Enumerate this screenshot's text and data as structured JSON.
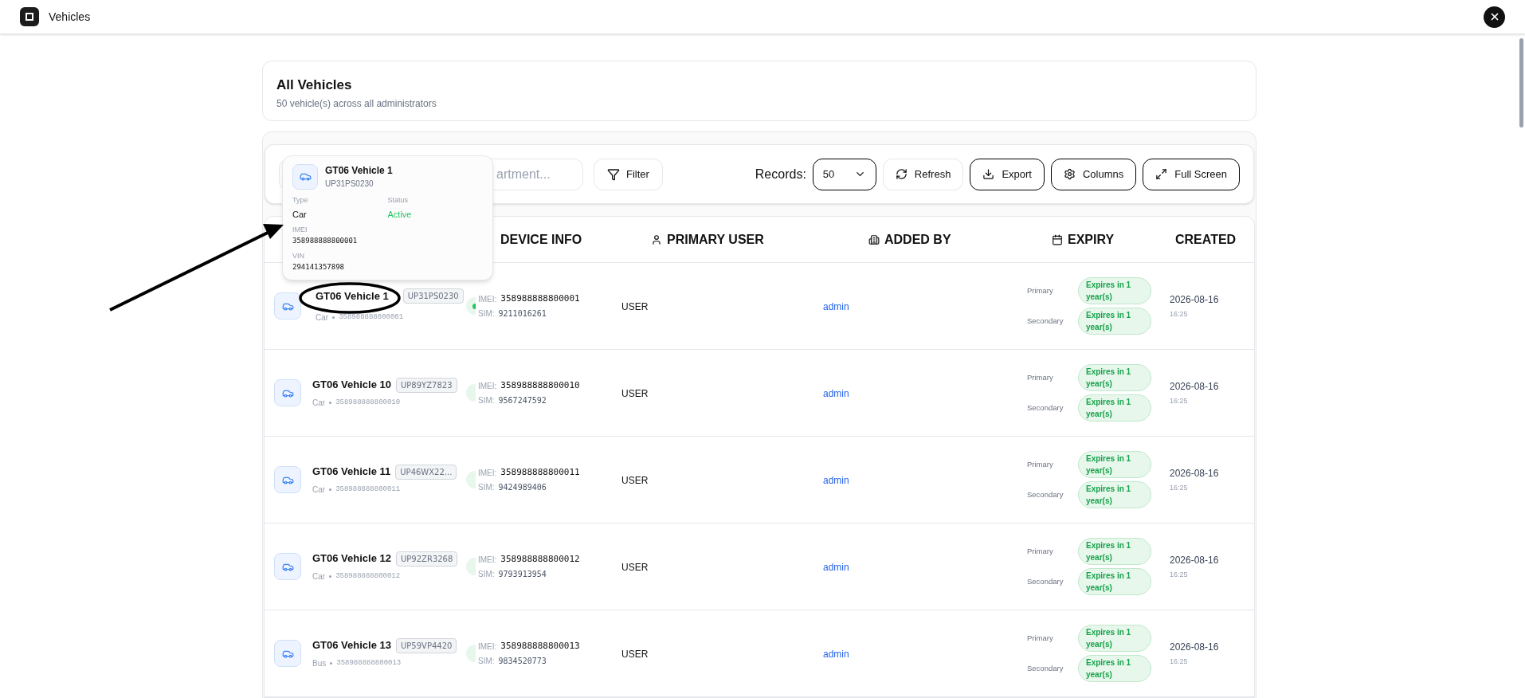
{
  "window": {
    "title": "Vehicles"
  },
  "header": {
    "title": "All Vehicles",
    "subtitle": "50 vehicle(s) across all administrators"
  },
  "toolbar": {
    "search": {
      "placeholder": "artment..."
    },
    "filter": "Filter",
    "records_label": "Records:",
    "records_value": "50",
    "buttons": [
      {
        "kind": "refresh",
        "label": "Refresh"
      },
      {
        "kind": "export",
        "label": "Export"
      },
      {
        "kind": "columns",
        "label": "Columns"
      },
      {
        "kind": "fullscreen",
        "label": "Full Screen"
      }
    ]
  },
  "tooltip": {
    "name": "GT06 Vehicle 1",
    "plate": "UP31PS0230",
    "type_label": "Type",
    "type": "Car",
    "status_label": "Status",
    "status": "Active",
    "imei_label": "IMEI",
    "imei": "358988888800001",
    "vin_label": "VIN",
    "vin": "294141357898"
  },
  "table": {
    "columns": [
      {
        "kind": "device",
        "label": "DEVICE INFO"
      },
      {
        "kind": "user",
        "label": "PRIMARY USER"
      },
      {
        "kind": "added",
        "label": "ADDED BY"
      },
      {
        "kind": "expiry",
        "label": "EXPIRY"
      },
      {
        "kind": "created",
        "label": "CREATED"
      }
    ],
    "rows": [
      {
        "name": "GT06 Vehicle 1",
        "plate": "UP31PS0230",
        "type": "Car",
        "imei_short": "358988888800001",
        "online": true,
        "imei_label": "IMEI:",
        "imei": "358988888800001",
        "sim_label": "SIM:",
        "sim": "9211016261",
        "user": "USER",
        "added_by": "admin",
        "expiry": [
          {
            "label": "Primary",
            "text": "Expires in 1 year(s)"
          },
          {
            "label": "Secondary",
            "text": "Expires in 1 year(s)"
          }
        ],
        "date": "2026-08-16",
        "time": "16:25"
      },
      {
        "name": "GT06 Vehicle 10",
        "plate": "UP89YZ7823",
        "type": "Car",
        "imei_short": "358988888800010",
        "online": false,
        "imei_label": "IMEI:",
        "imei": "358988888800010",
        "sim_label": "SIM:",
        "sim": "9567247592",
        "user": "USER",
        "added_by": "admin",
        "expiry": [
          {
            "label": "Primary",
            "text": "Expires in 1 year(s)"
          },
          {
            "label": "Secondary",
            "text": "Expires in 1 year(s)"
          }
        ],
        "date": "2026-08-16",
        "time": "16:25"
      },
      {
        "name": "GT06 Vehicle 11",
        "plate": "UP46WX22...",
        "type": "Car",
        "imei_short": "358988888800011",
        "online": false,
        "imei_label": "IMEI:",
        "imei": "358988888800011",
        "sim_label": "SIM:",
        "sim": "9424989406",
        "user": "USER",
        "added_by": "admin",
        "expiry": [
          {
            "label": "Primary",
            "text": "Expires in 1 year(s)"
          },
          {
            "label": "Secondary",
            "text": "Expires in 1 year(s)"
          }
        ],
        "date": "2026-08-16",
        "time": "16:25"
      },
      {
        "name": "GT06 Vehicle 12",
        "plate": "UP92ZR3268",
        "type": "Car",
        "imei_short": "358988888800012",
        "online": false,
        "imei_label": "IMEI:",
        "imei": "358988888800012",
        "sim_label": "SIM:",
        "sim": "9793913954",
        "user": "USER",
        "added_by": "admin",
        "expiry": [
          {
            "label": "Primary",
            "text": "Expires in 1 year(s)"
          },
          {
            "label": "Secondary",
            "text": "Expires in 1 year(s)"
          }
        ],
        "date": "2026-08-16",
        "time": "16:25"
      },
      {
        "name": "GT06 Vehicle 13",
        "plate": "UP59VP4420",
        "type": "Bus",
        "imei_short": "358988888800013",
        "online": false,
        "imei_label": "IMEI:",
        "imei": "358988888800013",
        "sim_label": "SIM:",
        "sim": "9834520773",
        "user": "USER",
        "added_by": "admin",
        "expiry": [
          {
            "label": "Primary",
            "text": "Expires in 1 year(s)"
          },
          {
            "label": "Secondary",
            "text": "Expires in 1 year(s)"
          }
        ],
        "date": "2026-08-16",
        "time": "16:25"
      }
    ]
  }
}
